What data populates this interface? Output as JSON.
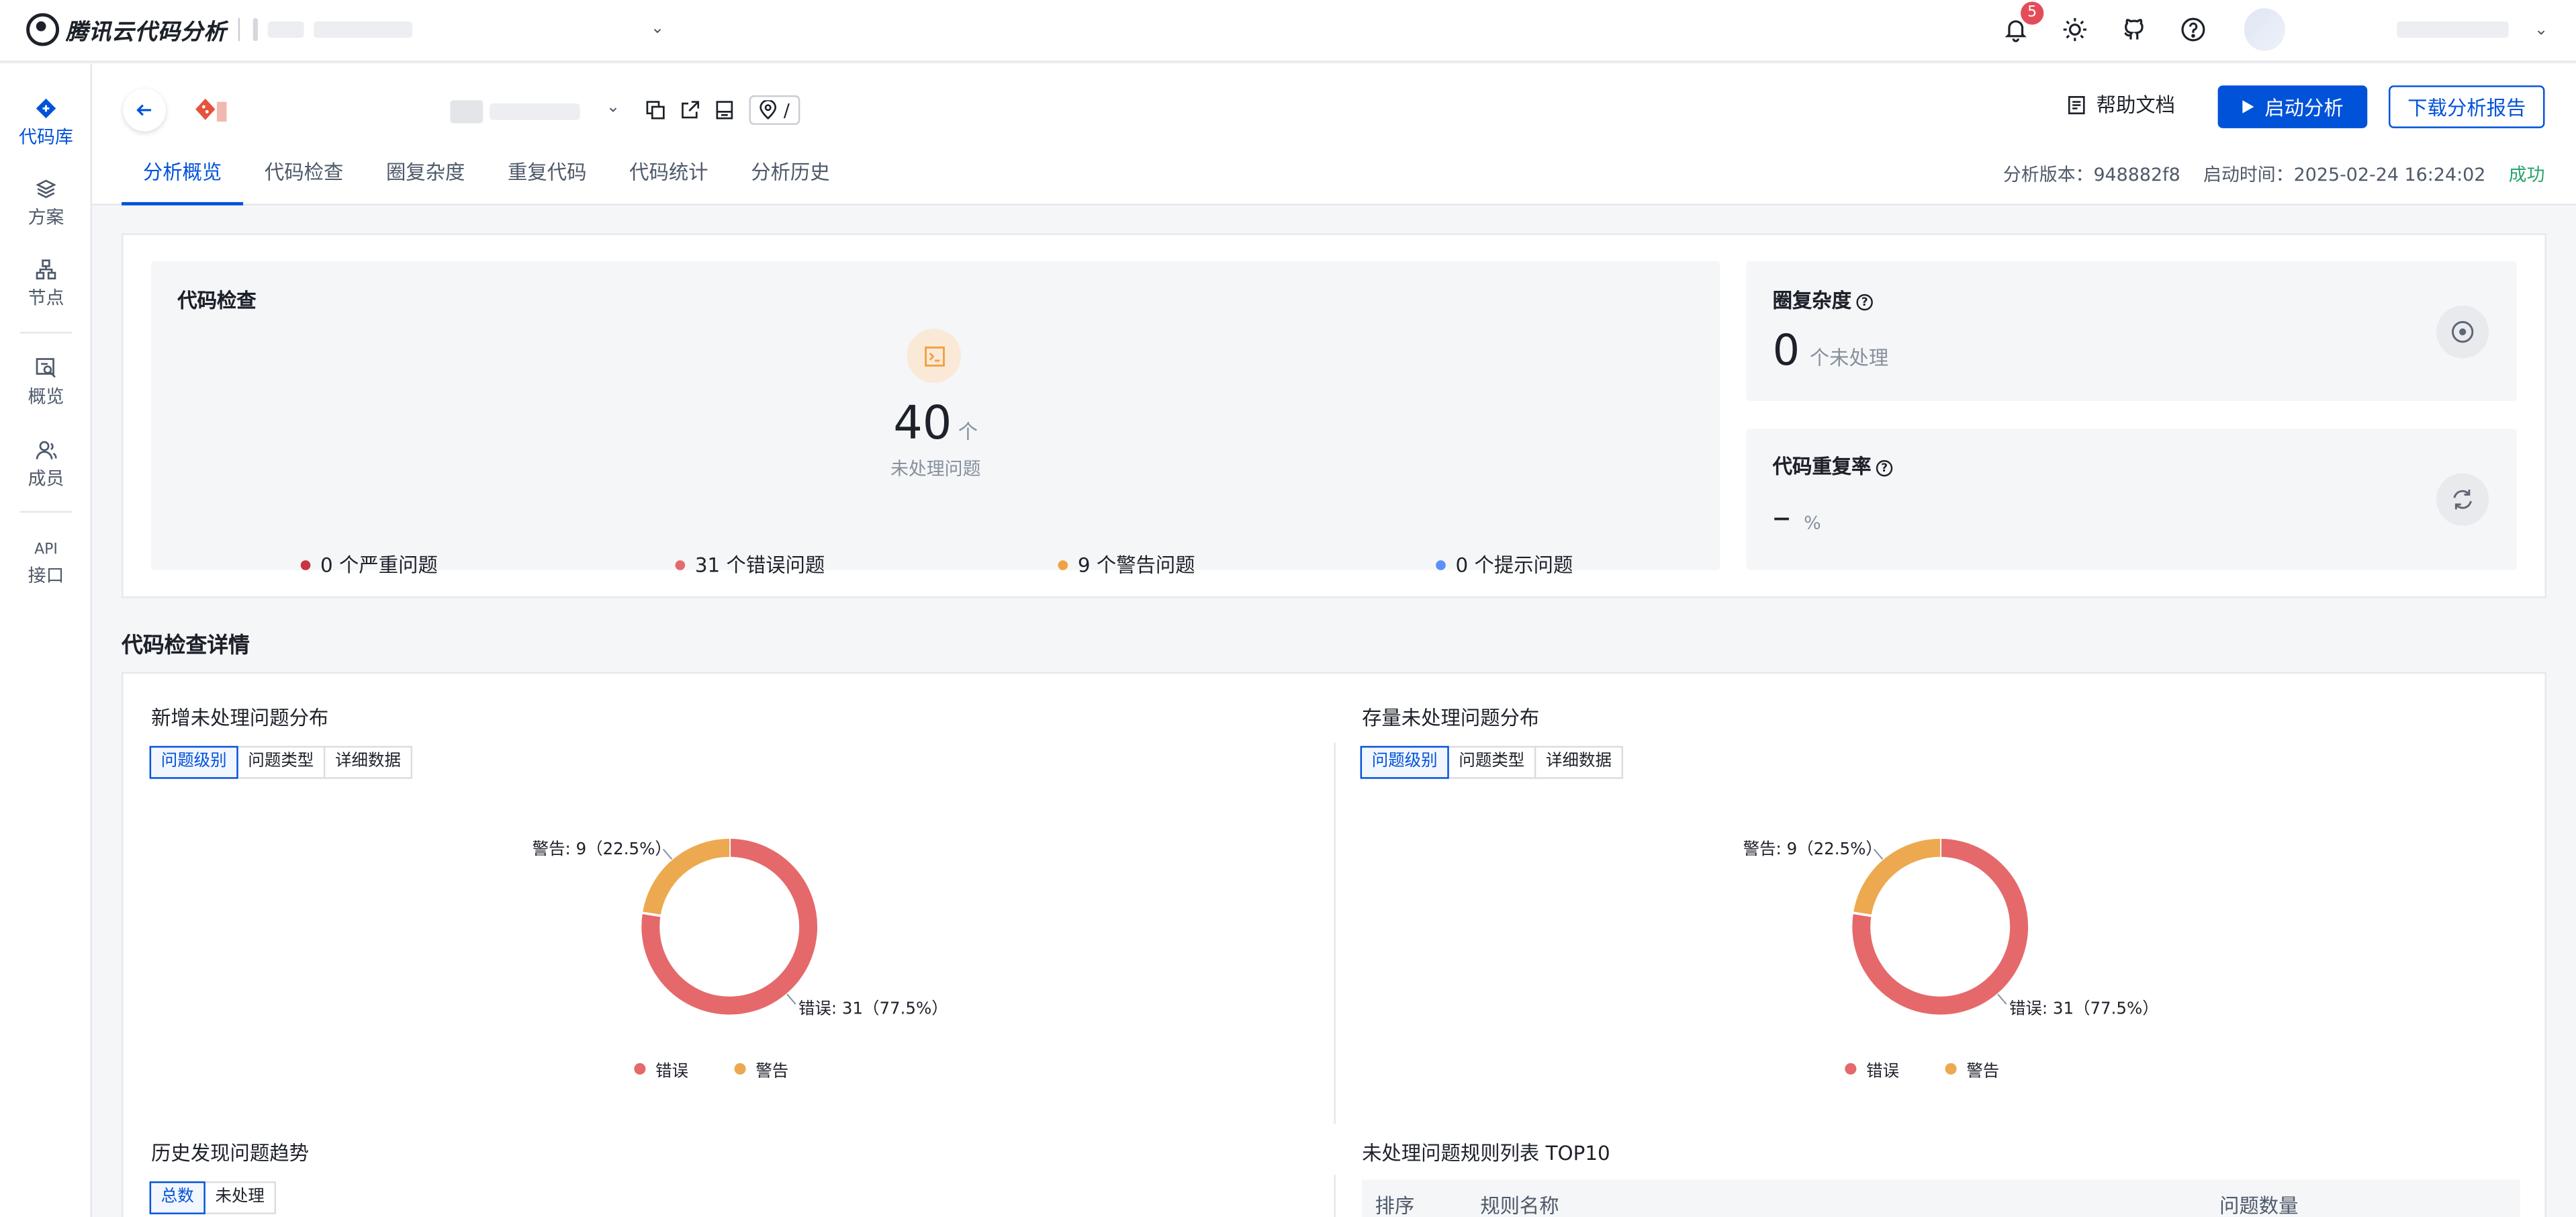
{
  "app": {
    "title": "腾讯云代码分析"
  },
  "topbar": {
    "notification_count": "5"
  },
  "sidebar": {
    "items": [
      {
        "label": "代码库",
        "icon": "codebase-icon"
      },
      {
        "label": "方案",
        "icon": "layers-icon"
      },
      {
        "label": "节点",
        "icon": "node-icon"
      },
      {
        "label": "概览",
        "icon": "overview-icon"
      },
      {
        "label": "成员",
        "icon": "members-icon"
      },
      {
        "label": "API",
        "label2": "接口"
      }
    ]
  },
  "header": {
    "path": "/",
    "help_doc": "帮助文档",
    "start_analysis": "启动分析",
    "download_report": "下载分析报告",
    "tabs": [
      "分析概览",
      "代码检查",
      "圈复杂度",
      "重复代码",
      "代码统计",
      "分析历史"
    ],
    "meta": {
      "version_label": "分析版本：948882f8",
      "start_time_label": "启动时间：2025-02-24 16:24:02",
      "status": "成功"
    }
  },
  "overview": {
    "code_check": {
      "title": "代码检查",
      "count": "40",
      "unit": "个",
      "subtitle": "未处理问题",
      "severities": [
        {
          "label": "0 个严重问题",
          "color": "#c9353f"
        },
        {
          "label": "31 个错误问题",
          "color": "#e5696b"
        },
        {
          "label": "9 个警告问题",
          "color": "#f0a243"
        },
        {
          "label": "0 个提示问题",
          "color": "#5b8ff9"
        }
      ]
    },
    "complexity": {
      "title": "圈复杂度",
      "value": "0",
      "unit": "个未处理"
    },
    "duplication": {
      "title": "代码重复率",
      "value": "–",
      "unit": "%"
    }
  },
  "details": {
    "title": "代码检查详情",
    "new_dist": {
      "title": "新增未处理问题分布",
      "segments": [
        "问题级别",
        "问题类型",
        "详细数据"
      ],
      "chart_data": {
        "type": "pie",
        "donut": true,
        "labels": [
          "错误",
          "警告"
        ],
        "values": [
          31,
          9
        ],
        "percents": [
          77.5,
          22.5
        ],
        "colors": [
          "#e5696b",
          "#eda94f"
        ],
        "data_labels": [
          "错误: 31（77.5%）",
          "警告: 9（22.5%）"
        ],
        "legend": "bottom"
      }
    },
    "stock_dist": {
      "title": "存量未处理问题分布",
      "segments": [
        "问题级别",
        "问题类型",
        "详细数据"
      ],
      "chart_data": {
        "type": "pie",
        "donut": true,
        "labels": [
          "错误",
          "警告"
        ],
        "values": [
          31,
          9
        ],
        "percents": [
          77.5,
          22.5
        ],
        "colors": [
          "#e5696b",
          "#eda94f"
        ],
        "data_labels": [
          "错误: 31（77.5%）",
          "警告: 9（22.5%）"
        ],
        "legend": "bottom"
      }
    },
    "history": {
      "title": "历史发现问题趋势",
      "segments": [
        "总数",
        "未处理"
      ]
    },
    "top10": {
      "title": "未处理问题规则列表 TOP10",
      "columns": [
        "排序",
        "规则名称",
        "问题数量"
      ]
    }
  }
}
